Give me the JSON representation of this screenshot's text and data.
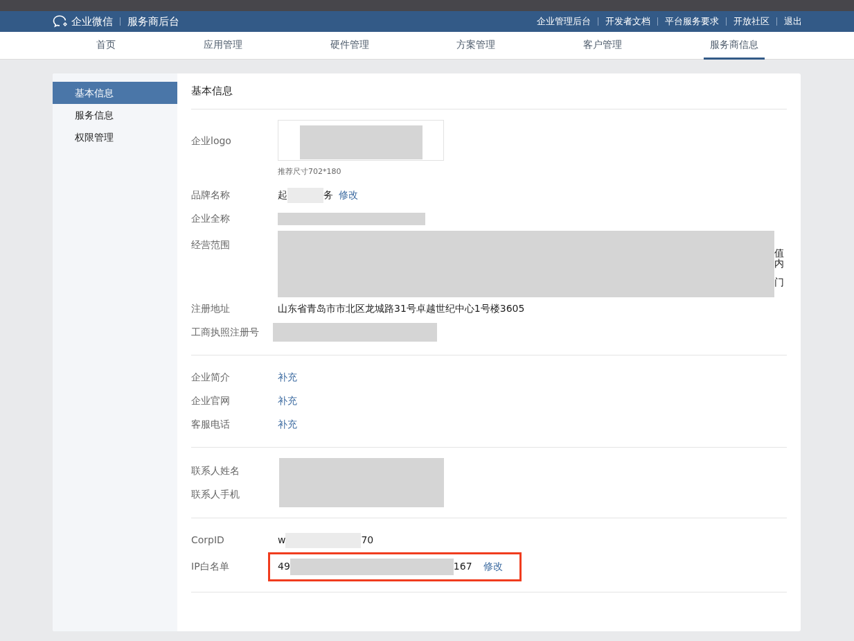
{
  "header": {
    "brand": "企业微信",
    "subtitle": "服务商后台",
    "links": [
      "企业管理后台",
      "开发者文档",
      "平台服务要求",
      "开放社区",
      "退出"
    ]
  },
  "nav": [
    {
      "label": "首页",
      "selected": false
    },
    {
      "label": "应用管理",
      "selected": false
    },
    {
      "label": "硬件管理",
      "selected": false
    },
    {
      "label": "方案管理",
      "selected": false
    },
    {
      "label": "客户管理",
      "selected": false
    },
    {
      "label": "服务商信息",
      "selected": true
    }
  ],
  "sidebar": [
    {
      "label": "基本信息",
      "selected": true
    },
    {
      "label": "服务信息",
      "selected": false
    },
    {
      "label": "权限管理",
      "selected": false
    }
  ],
  "page_title": "基本信息",
  "sections": [
    {
      "kind": "rows",
      "rows": [
        {
          "label": "企业logo",
          "kind": "logo",
          "hint": "推荐尺寸702*180"
        },
        {
          "label": "品牌名称",
          "kind": "partial",
          "prefix": "起",
          "suffix": "务",
          "action": "修改",
          "highlighted": false
        },
        {
          "label": "企业全称",
          "kind": "redacted"
        },
        {
          "label": "经营范围",
          "kind": "redacted_block",
          "fragments": [
            "值",
            "内",
            "门"
          ]
        },
        {
          "label": "注册地址",
          "kind": "text",
          "value": "山东省青岛市市北区龙城路31号卓越世纪中心1号楼3605"
        },
        {
          "label": "工商执照注册号",
          "kind": "redacted"
        }
      ]
    },
    {
      "kind": "rows",
      "rows": [
        {
          "label": "企业简介",
          "kind": "link",
          "action": "补充"
        },
        {
          "label": "企业官网",
          "kind": "link",
          "action": "补充"
        },
        {
          "label": "客服电话",
          "kind": "link",
          "action": "补充"
        }
      ]
    },
    {
      "kind": "grouped",
      "labels": [
        "联系人姓名",
        "联系人手机"
      ]
    },
    {
      "kind": "rows",
      "rows": [
        {
          "label": "CorpID",
          "kind": "partial",
          "prefix": "w",
          "suffix": "70",
          "highlighted": false
        },
        {
          "label": "IP白名单",
          "kind": "partial",
          "prefix": "49",
          "suffix": "167",
          "action": "修改",
          "highlighted": true
        }
      ]
    }
  ]
}
